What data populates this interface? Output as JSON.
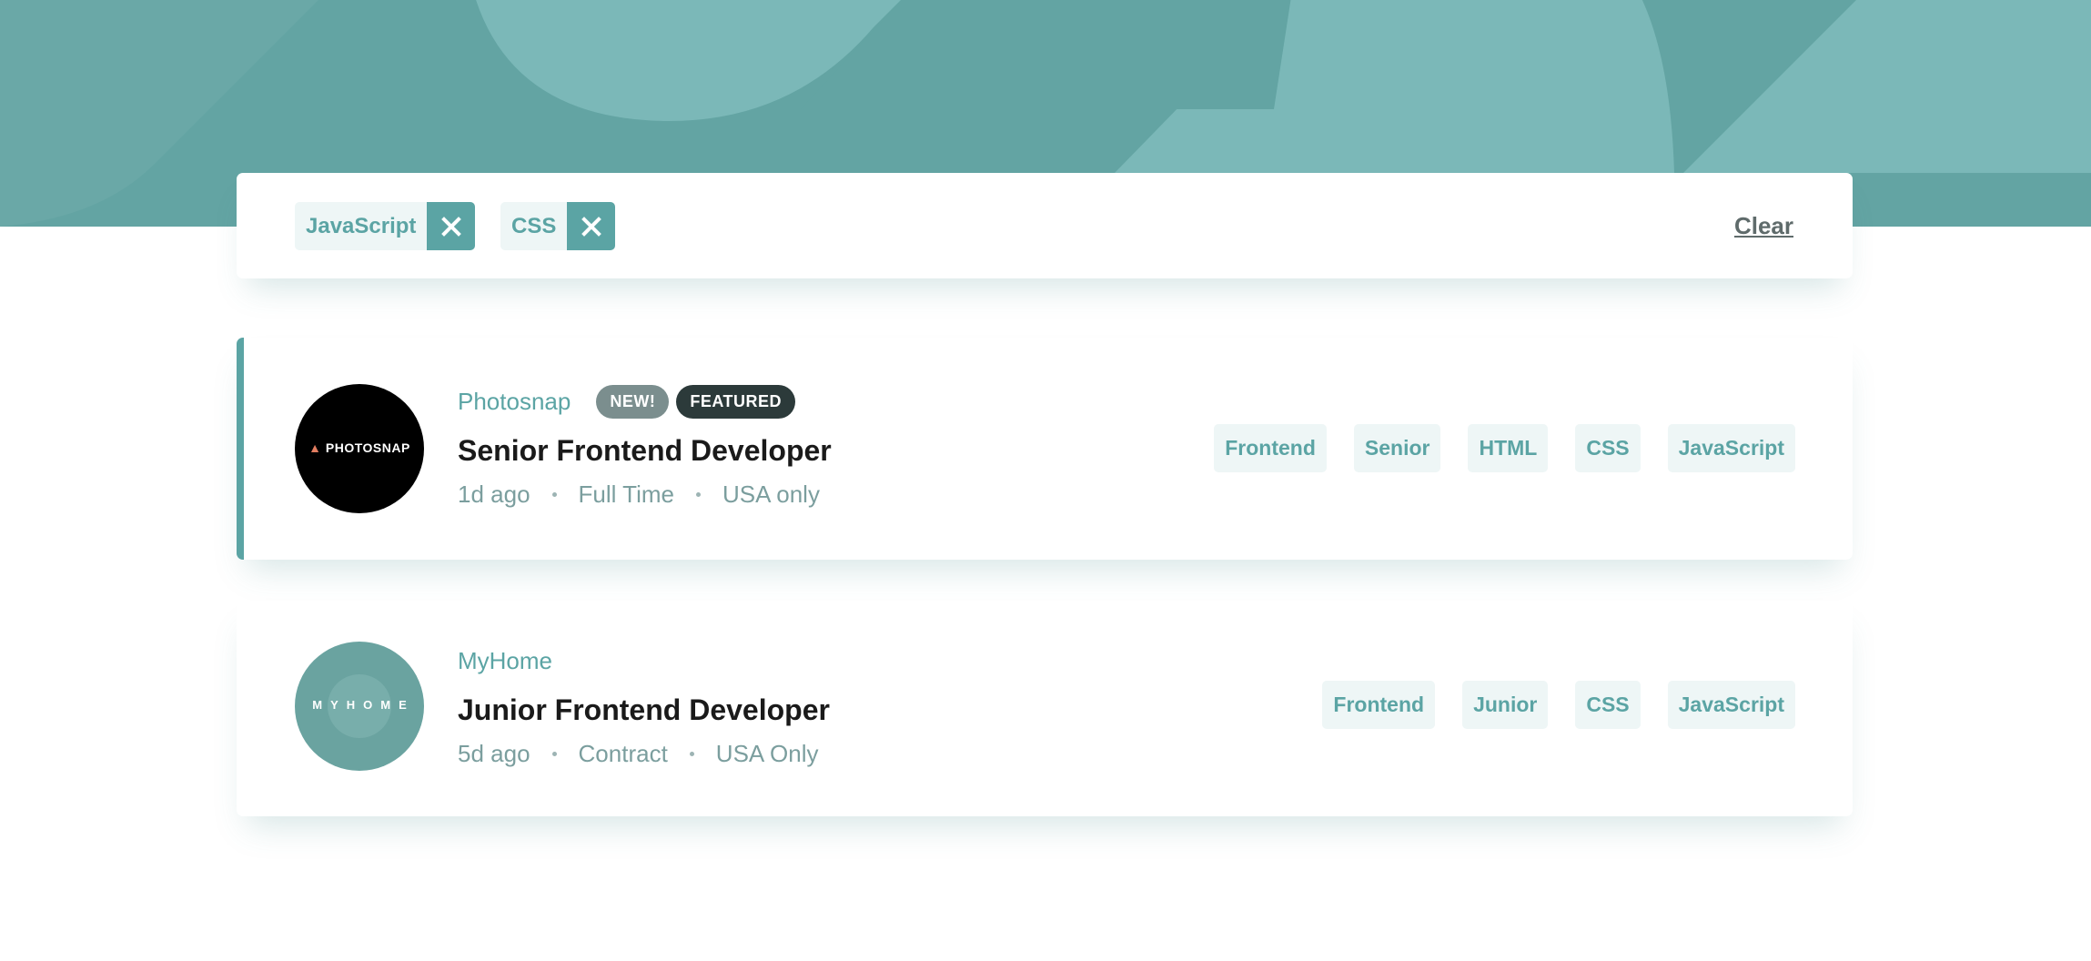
{
  "colors": {
    "header_dark": "#63a4a3",
    "header_light": "#7bb8b8",
    "accent": "#5ba4a4",
    "tag_bg": "#eef6f6",
    "badge_new": "#7b8e8e",
    "badge_featured": "#2c3a3a"
  },
  "filters": {
    "chips": [
      {
        "label": "JavaScript",
        "remove_icon": "close-icon"
      },
      {
        "label": "CSS",
        "remove_icon": "close-icon"
      }
    ],
    "clear_label": "Clear"
  },
  "jobs": [
    {
      "logo_text": "PHOTOSNAP",
      "company": "Photosnap",
      "badge_new": "NEW!",
      "badge_featured": "FEATURED",
      "position": "Senior Frontend Developer",
      "posted": "1d ago",
      "contract": "Full Time",
      "location": "USA only",
      "tags": [
        "Frontend",
        "Senior",
        "HTML",
        "CSS",
        "JavaScript"
      ]
    },
    {
      "logo_text": "MYHOME",
      "company": "MyHome",
      "position": "Junior Frontend Developer",
      "posted": "5d ago",
      "contract": "Contract",
      "location": "USA Only",
      "tags": [
        "Frontend",
        "Junior",
        "CSS",
        "JavaScript"
      ]
    }
  ]
}
